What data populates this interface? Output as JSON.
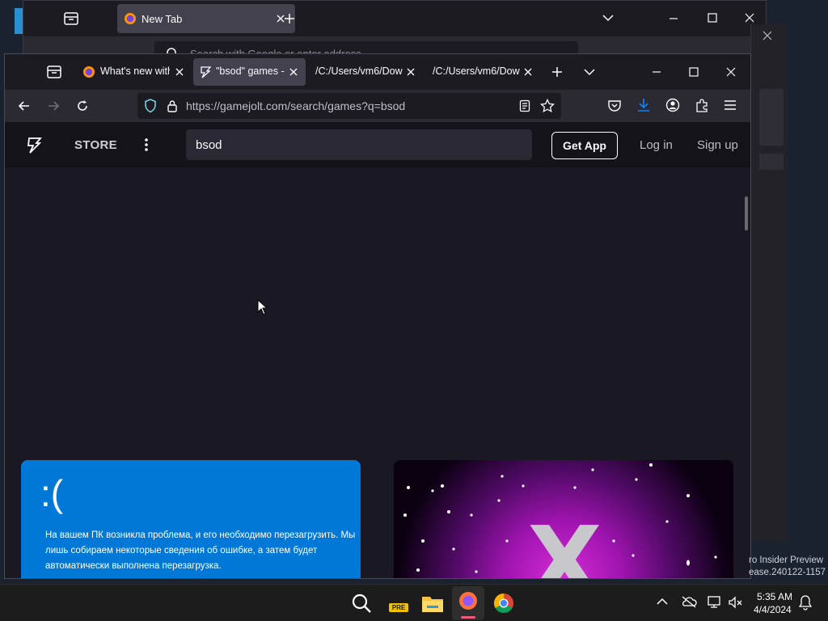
{
  "back_window": {
    "tab_title": "New Tab",
    "url_placeholder": "Search with Google or enter address"
  },
  "tabs": [
    {
      "label": "What's new with",
      "active": false
    },
    {
      "label": "\"bsod\" games -",
      "active": true
    },
    {
      "label": "/C:/Users/vm6/Dow",
      "active": false
    },
    {
      "label": "/C:/Users/vm6/Dow",
      "active": false
    }
  ],
  "url": "https://gamejolt.com/search/games?q=bsod",
  "site": {
    "store_label": "STORE",
    "search_value": "bsod",
    "get_app_label": "Get App",
    "login_label": "Log in",
    "signup_label": "Sign up"
  },
  "cards": [
    {
      "face": ":(",
      "message": "На вашем ПК возникла проблема, и его необходимо перезагрузить. Мы лишь собираем некоторые сведения об ошибке, а затем будет автоматически выполнена перезагрузка."
    },
    {
      "big_letter": "X"
    }
  ],
  "desktop": {
    "insider_line1": "ro Insider Preview",
    "insider_line2": "ease.240122-1157"
  },
  "taskbar": {
    "time": "5:35 AM",
    "date": "4/4/2024",
    "pre_badge": "PRE"
  },
  "colors": {
    "bsod_blue": "#0078d7",
    "accent_download": "#0a84ff",
    "firefox_indicator": "#f05b79"
  }
}
